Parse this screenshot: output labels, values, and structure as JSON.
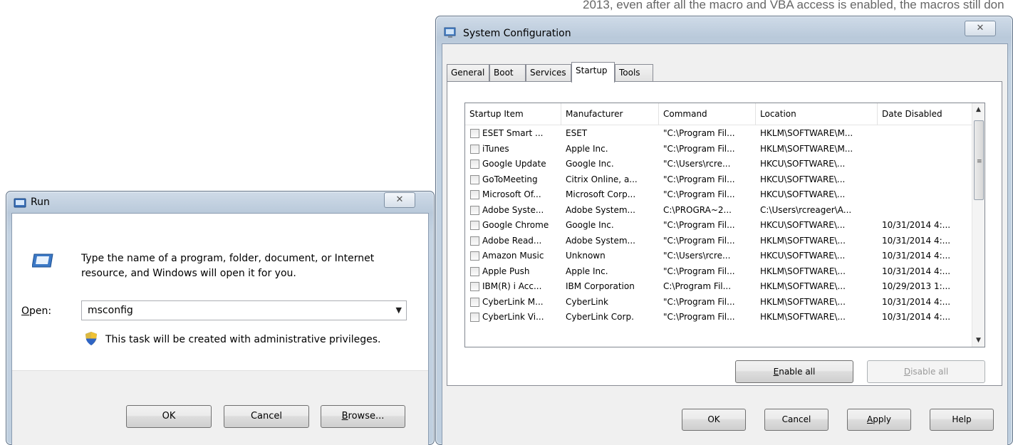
{
  "background_text": "2013, even after all the macro and VBA access is enabled, the macros still don",
  "run_dialog": {
    "title": "Run",
    "close": "✕",
    "description": "Type the name of a program, folder, document, or Internet resource, and Windows will open it for you.",
    "open_label_accel": "O",
    "open_label_rest": "pen:",
    "open_value": "msconfig",
    "admin_note": "This task will be created with administrative privileges.",
    "ok": "OK",
    "cancel": "Cancel",
    "browse_accel": "B",
    "browse_rest": "rowse..."
  },
  "sysconfig": {
    "title": "System Configuration",
    "close": "✕",
    "tabs": [
      "General",
      "Boot",
      "Services",
      "Startup",
      "Tools"
    ],
    "active_tab": "Startup",
    "columns": [
      "Startup Item",
      "Manufacturer",
      "Command",
      "Location",
      "Date Disabled"
    ],
    "rows": [
      {
        "item": "ESET Smart ...",
        "manufacturer": "ESET",
        "command": "\"C:\\Program Fil...",
        "location": "HKLM\\SOFTWARE\\M...",
        "date": ""
      },
      {
        "item": "iTunes",
        "manufacturer": "Apple Inc.",
        "command": "\"C:\\Program Fil...",
        "location": "HKLM\\SOFTWARE\\M...",
        "date": ""
      },
      {
        "item": "Google Update",
        "manufacturer": "Google Inc.",
        "command": "\"C:\\Users\\rcre...",
        "location": "HKCU\\SOFTWARE\\...",
        "date": ""
      },
      {
        "item": "GoToMeeting",
        "manufacturer": "Citrix Online, a...",
        "command": "\"C:\\Program Fil...",
        "location": "HKCU\\SOFTWARE\\...",
        "date": ""
      },
      {
        "item": "Microsoft Of...",
        "manufacturer": "Microsoft Corp...",
        "command": "\"C:\\Program Fil...",
        "location": "HKCU\\SOFTWARE\\...",
        "date": ""
      },
      {
        "item": "Adobe Syste...",
        "manufacturer": "Adobe System...",
        "command": "C:\\PROGRA~2...",
        "location": "C:\\Users\\rcreager\\A...",
        "date": ""
      },
      {
        "item": "Google Chrome",
        "manufacturer": "Google Inc.",
        "command": "\"C:\\Program Fil...",
        "location": "HKCU\\SOFTWARE\\...",
        "date": "10/31/2014 4:..."
      },
      {
        "item": "Adobe Read...",
        "manufacturer": "Adobe System...",
        "command": "\"C:\\Program Fil...",
        "location": "HKLM\\SOFTWARE\\...",
        "date": "10/31/2014 4:..."
      },
      {
        "item": "Amazon Music",
        "manufacturer": "Unknown",
        "command": "\"C:\\Users\\rcre...",
        "location": "HKCU\\SOFTWARE\\...",
        "date": "10/31/2014 4:..."
      },
      {
        "item": "Apple Push",
        "manufacturer": "Apple Inc.",
        "command": "\"C:\\Program Fil...",
        "location": "HKLM\\SOFTWARE\\...",
        "date": "10/31/2014 4:..."
      },
      {
        "item": "IBM(R) i Acc...",
        "manufacturer": "IBM Corporation",
        "command": "C:\\Program Fil...",
        "location": "HKLM\\SOFTWARE\\...",
        "date": "10/29/2013 1:..."
      },
      {
        "item": "CyberLink M...",
        "manufacturer": "CyberLink",
        "command": "\"C:\\Program Fil...",
        "location": "HKLM\\SOFTWARE\\...",
        "date": "10/31/2014 4:..."
      },
      {
        "item": "CyberLink Vi...",
        "manufacturer": "CyberLink Corp.",
        "command": "\"C:\\Program Fil...",
        "location": "HKLM\\SOFTWARE\\...",
        "date": "10/31/2014 4:..."
      }
    ],
    "enable_all_accel": "E",
    "enable_all_rest": "nable all",
    "disable_all_accel": "D",
    "disable_all_rest": "isable all",
    "ok": "OK",
    "cancel": "Cancel",
    "apply_accel": "A",
    "apply_rest": "pply",
    "help": "Help"
  }
}
